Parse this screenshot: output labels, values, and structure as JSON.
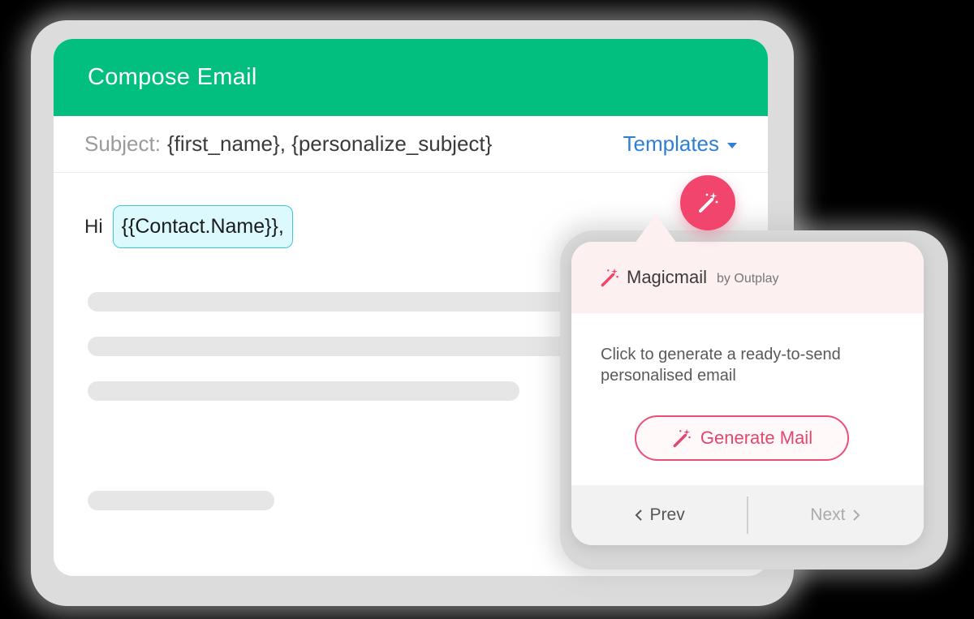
{
  "compose": {
    "title": "Compose Email",
    "subject_label": "Subject:",
    "subject_value": "{first_name}, {personalize_subject}",
    "templates_label": "Templates",
    "greeting": "Hi",
    "contact_token": "{{Contact.Name}},"
  },
  "magic_button": {
    "icon": "magic-wand-icon"
  },
  "popup": {
    "brand": "Magicmail",
    "brand_suffix": "by Outplay",
    "description": "Click to generate a ready-to-send personalised email",
    "generate_label": "Generate Mail",
    "prev_label": "Prev",
    "next_label": "Next"
  },
  "colors": {
    "header_green": "#02bf7f",
    "accent_pink": "#f2456e",
    "link_blue": "#2f7fd7",
    "chip_cyan": "#3ec7dc"
  }
}
